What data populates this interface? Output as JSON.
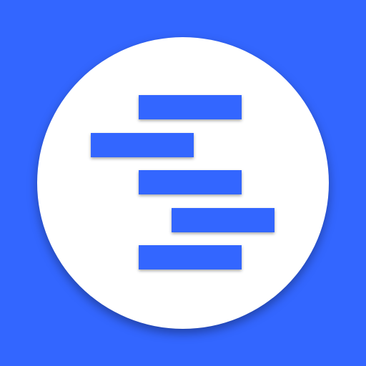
{
  "icon": {
    "name": "gantt-chart-icon",
    "background_color": "#3366ff",
    "badge_color": "#ffffff",
    "bar_color": "#3366ff",
    "bar_count": 5
  }
}
